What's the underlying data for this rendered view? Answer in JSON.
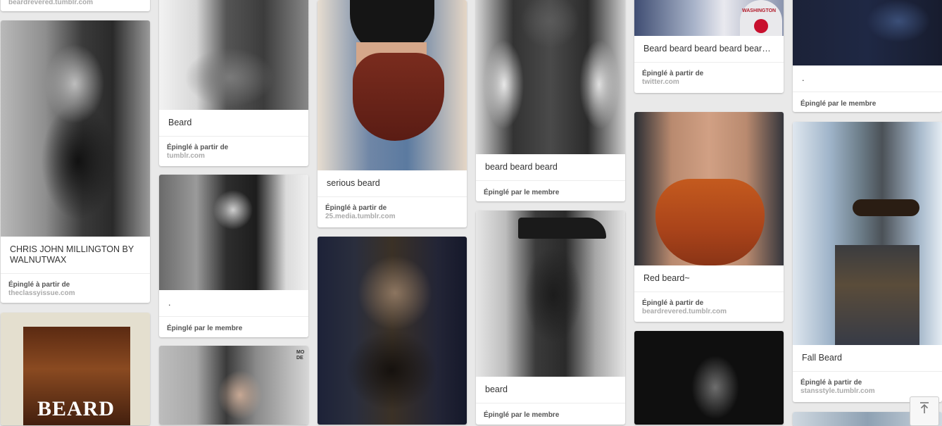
{
  "pins": [
    {
      "id": "c1a",
      "source": "beardrevered.tumblr.com"
    },
    {
      "id": "c1b",
      "description": "CHRIS JOHN MILLINGTON BY WALNUTWAX",
      "attribution": "Épinglé à partir de",
      "source": "theclassyissue.com"
    },
    {
      "id": "c1c",
      "overlay": "BEARD"
    },
    {
      "id": "c2a",
      "description": "Beard",
      "attribution": "Épinglé à partir de",
      "source": "tumblr.com"
    },
    {
      "id": "c2b",
      "description": ".",
      "attribution": "Épinglé par le membre"
    },
    {
      "id": "c2c",
      "overlay": "MO DE"
    },
    {
      "id": "c3a",
      "description": "serious beard",
      "attribution": "Épinglé à partir de",
      "source": "25.media.tumblr.com"
    },
    {
      "id": "c3b"
    },
    {
      "id": "c4a",
      "description": "beard beard beard",
      "attribution": "Épinglé par le membre"
    },
    {
      "id": "c4b",
      "description": "beard",
      "attribution": "Épinglé par le membre"
    },
    {
      "id": "c5a",
      "description": "Beard beard beard beard beard ...",
      "attribution": "Épinglé à partir de",
      "source": "twitter.com",
      "overlay": "WASHINGTON"
    },
    {
      "id": "c5b",
      "description": "Red beard~",
      "attribution": "Épinglé à partir de",
      "source": "beardrevered.tumblr.com"
    },
    {
      "id": "c5c"
    },
    {
      "id": "c6a",
      "description": ".",
      "attribution": "Épinglé par le membre"
    },
    {
      "id": "c6b",
      "description": "Fall Beard",
      "attribution": "Épinglé à partir de",
      "source": "stansstyle.tumblr.com"
    },
    {
      "id": "c6c"
    }
  ],
  "scroll_top_icon": "arrow-up-to-top-icon"
}
